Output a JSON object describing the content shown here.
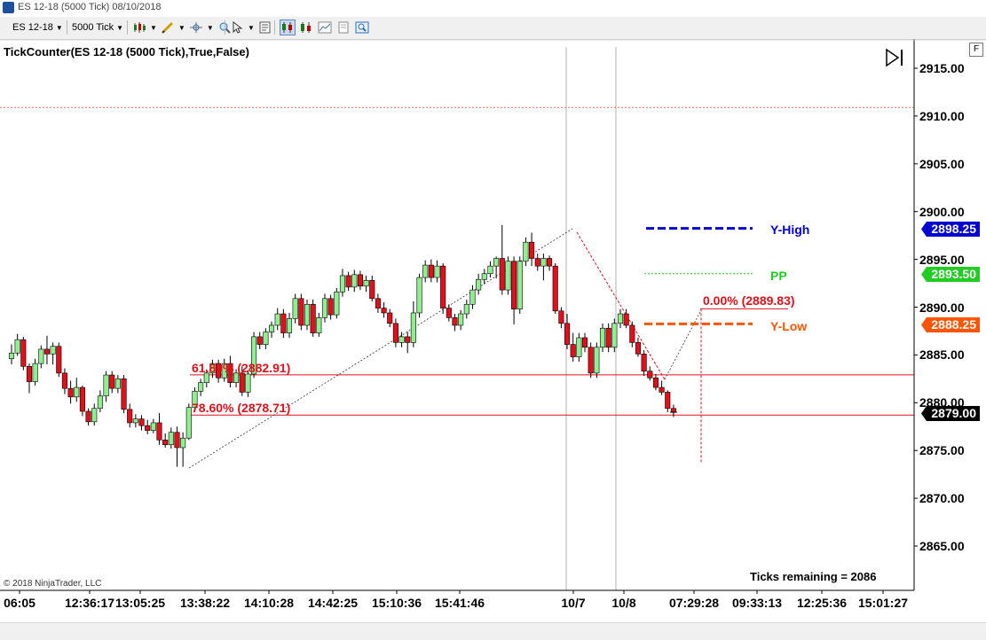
{
  "window": {
    "title": "ES 12-18 (5000 Tick)  08/10/2018"
  },
  "toolbar": {
    "instrument": "ES 12-18",
    "interval": "5000 Tick",
    "icons": [
      "bars-icon",
      "pencil-icon",
      "crosshair-icon",
      "zoom-icon",
      "pointer-icon",
      "chart-style-icon",
      "data-box-icon",
      "properties-icon"
    ]
  },
  "panel": {
    "f_label": "F"
  },
  "indicator": {
    "label": "TickCounter(ES 12-18 (5000 Tick),True,False)",
    "ticks_remaining": "Ticks remaining = 2086"
  },
  "copyright": "© 2018 NinjaTrader, LLC",
  "colors": {
    "up": "#90ee90",
    "down": "#e2101b",
    "yhigh": "#0000d0",
    "pp": "#22cc22",
    "ylow": "#ff5500",
    "fib": "#e2101b",
    "last": "#000000"
  },
  "chart_data": {
    "type": "candlestick",
    "ylim": [
      2861.5,
      2917.5
    ],
    "yticks": [
      "2915.00",
      "2910.00",
      "2905.00",
      "2900.00",
      "2895.00",
      "2890.00",
      "2885.00",
      "2880.00",
      "2875.00",
      "2870.00",
      "2865.00"
    ],
    "xticks": [
      "06:05",
      "12:36:17",
      "13:05:25",
      "13:38:22",
      "14:10:28",
      "14:42:25",
      "15:10:36",
      "15:41:46",
      "10/7",
      "10/8",
      "07:29:28",
      "09:33:13",
      "12:25:36",
      "15:01:27"
    ],
    "candles": [
      [
        2884.6,
        2886.1,
        2884.0,
        2885.2
      ],
      [
        2885.2,
        2887.2,
        2884.9,
        2886.6
      ],
      [
        2886.6,
        2886.9,
        2883.4,
        2883.8
      ],
      [
        2883.8,
        2884.1,
        2881.0,
        2882.2
      ],
      [
        2882.2,
        2884.6,
        2881.8,
        2884.1
      ],
      [
        2884.1,
        2886.0,
        2883.6,
        2885.6
      ],
      [
        2885.6,
        2887.0,
        2884.0,
        2885.1
      ],
      [
        2885.1,
        2886.3,
        2884.0,
        2885.9
      ],
      [
        2885.9,
        2886.3,
        2882.7,
        2883.1
      ],
      [
        2883.1,
        2883.6,
        2880.9,
        2881.5
      ],
      [
        2881.5,
        2882.3,
        2879.9,
        2880.6
      ],
      [
        2880.6,
        2882.6,
        2880.1,
        2881.6
      ],
      [
        2881.6,
        2881.8,
        2878.6,
        2879.1
      ],
      [
        2879.1,
        2879.4,
        2877.6,
        2878.0
      ],
      [
        2878.0,
        2879.9,
        2877.6,
        2879.4
      ],
      [
        2879.4,
        2881.3,
        2879.0,
        2880.7
      ],
      [
        2880.7,
        2883.3,
        2880.1,
        2882.9
      ],
      [
        2882.9,
        2883.3,
        2881.0,
        2881.5
      ],
      [
        2881.5,
        2882.9,
        2881.0,
        2882.5
      ],
      [
        2882.5,
        2882.9,
        2878.9,
        2879.3
      ],
      [
        2879.3,
        2879.9,
        2877.4,
        2877.9
      ],
      [
        2877.9,
        2878.8,
        2877.4,
        2878.3
      ],
      [
        2878.3,
        2878.7,
        2877.1,
        2877.6
      ],
      [
        2877.6,
        2878.2,
        2876.7,
        2877.1
      ],
      [
        2877.1,
        2878.3,
        2876.8,
        2877.9
      ],
      [
        2877.9,
        2878.9,
        2875.6,
        2876.1
      ],
      [
        2876.1,
        2876.8,
        2875.3,
        2875.6
      ],
      [
        2875.6,
        2877.4,
        2875.2,
        2876.9
      ],
      [
        2876.9,
        2877.5,
        2873.3,
        2875.3
      ],
      [
        2875.3,
        2876.9,
        2873.3,
        2876.3
      ],
      [
        2876.3,
        2879.9,
        2876.1,
        2879.5
      ],
      [
        2879.5,
        2881.6,
        2879.0,
        2881.2
      ],
      [
        2881.2,
        2882.5,
        2880.7,
        2882.1
      ],
      [
        2882.1,
        2883.5,
        2881.6,
        2883.1
      ],
      [
        2883.1,
        2884.5,
        2882.6,
        2884.1
      ],
      [
        2884.1,
        2884.5,
        2882.1,
        2882.6
      ],
      [
        2882.6,
        2884.6,
        2882.2,
        2884.1
      ],
      [
        2884.1,
        2884.9,
        2881.6,
        2882.1
      ],
      [
        2882.1,
        2883.5,
        2881.6,
        2883.1
      ],
      [
        2883.1,
        2883.8,
        2880.7,
        2881.1
      ],
      [
        2881.1,
        2883.4,
        2880.6,
        2883.0
      ],
      [
        2883.0,
        2887.4,
        2882.6,
        2886.9
      ],
      [
        2886.9,
        2887.4,
        2885.6,
        2886.1
      ],
      [
        2886.1,
        2887.8,
        2885.6,
        2887.4
      ],
      [
        2887.4,
        2888.5,
        2886.8,
        2888.1
      ],
      [
        2888.1,
        2889.9,
        2887.6,
        2889.3
      ],
      [
        2889.3,
        2889.8,
        2886.8,
        2887.3
      ],
      [
        2887.3,
        2889.4,
        2886.8,
        2888.8
      ],
      [
        2888.8,
        2891.4,
        2888.3,
        2890.9
      ],
      [
        2890.9,
        2891.4,
        2887.6,
        2888.1
      ],
      [
        2888.1,
        2890.8,
        2887.6,
        2890.3
      ],
      [
        2890.3,
        2890.8,
        2886.9,
        2887.3
      ],
      [
        2887.3,
        2889.4,
        2886.9,
        2888.9
      ],
      [
        2888.9,
        2891.4,
        2888.4,
        2890.9
      ],
      [
        2890.9,
        2891.3,
        2888.7,
        2889.2
      ],
      [
        2889.2,
        2892.0,
        2888.8,
        2891.6
      ],
      [
        2891.6,
        2894.0,
        2891.1,
        2893.3
      ],
      [
        2893.3,
        2893.7,
        2891.7,
        2892.1
      ],
      [
        2892.1,
        2893.9,
        2891.6,
        2893.4
      ],
      [
        2893.4,
        2893.8,
        2891.8,
        2892.2
      ],
      [
        2892.2,
        2893.3,
        2891.6,
        2892.8
      ],
      [
        2892.8,
        2893.3,
        2890.6,
        2890.9
      ],
      [
        2890.9,
        2891.4,
        2889.4,
        2889.9
      ],
      [
        2889.9,
        2890.5,
        2888.9,
        2889.4
      ],
      [
        2889.4,
        2889.8,
        2887.9,
        2888.3
      ],
      [
        2888.3,
        2888.8,
        2885.8,
        2886.3
      ],
      [
        2886.3,
        2887.4,
        2885.8,
        2886.9
      ],
      [
        2886.9,
        2887.4,
        2885.2,
        2886.3
      ],
      [
        2886.3,
        2890.6,
        2885.8,
        2889.4
      ],
      [
        2889.4,
        2893.5,
        2888.9,
        2893.1
      ],
      [
        2893.1,
        2894.9,
        2892.6,
        2894.4
      ],
      [
        2894.4,
        2895.0,
        2892.6,
        2893.1
      ],
      [
        2893.1,
        2894.9,
        2892.6,
        2894.3
      ],
      [
        2894.3,
        2894.6,
        2889.3,
        2889.9
      ],
      [
        2889.9,
        2890.3,
        2888.5,
        2888.9
      ],
      [
        2888.9,
        2889.3,
        2887.5,
        2888.1
      ],
      [
        2888.1,
        2889.7,
        2887.6,
        2889.3
      ],
      [
        2889.3,
        2890.8,
        2888.8,
        2890.3
      ],
      [
        2890.3,
        2892.3,
        2889.8,
        2891.8
      ],
      [
        2891.8,
        2893.5,
        2891.3,
        2892.9
      ],
      [
        2892.9,
        2894.0,
        2892.4,
        2893.5
      ],
      [
        2893.5,
        2894.8,
        2893.1,
        2894.3
      ],
      [
        2894.3,
        2895.3,
        2893.0,
        2895.1
      ],
      [
        2895.1,
        2898.6,
        2891.3,
        2891.8
      ],
      [
        2891.8,
        2895.3,
        2891.3,
        2894.8
      ],
      [
        2894.8,
        2895.3,
        2888.2,
        2889.8
      ],
      [
        2889.8,
        2895.3,
        2889.3,
        2894.8
      ],
      [
        2894.8,
        2897.3,
        2894.3,
        2896.8
      ],
      [
        2896.8,
        2897.8,
        2894.3,
        2895.1
      ],
      [
        2895.1,
        2895.6,
        2893.8,
        2894.3
      ],
      [
        2894.3,
        2895.6,
        2892.8,
        2895.1
      ],
      [
        2895.1,
        2895.4,
        2893.8,
        2894.3
      ],
      [
        2894.3,
        2894.6,
        2889.3,
        2889.6
      ],
      [
        2889.6,
        2890.0,
        2887.8,
        2888.3
      ],
      [
        2888.3,
        2889.3,
        2885.6,
        2886.1
      ],
      [
        2886.1,
        2887.3,
        2884.3,
        2884.8
      ],
      [
        2884.8,
        2887.3,
        2884.3,
        2886.8
      ],
      [
        2886.8,
        2887.3,
        2885.3,
        2885.8
      ],
      [
        2885.8,
        2886.3,
        2882.6,
        2883.1
      ],
      [
        2883.1,
        2886.3,
        2882.6,
        2885.8
      ],
      [
        2885.8,
        2888.3,
        2885.3,
        2887.8
      ],
      [
        2887.8,
        2888.3,
        2885.3,
        2885.8
      ],
      [
        2885.8,
        2888.8,
        2885.3,
        2888.3
      ],
      [
        2888.3,
        2889.8,
        2887.8,
        2889.3
      ],
      [
        2889.3,
        2889.8,
        2887.8,
        2888.1
      ],
      [
        2888.1,
        2888.5,
        2885.8,
        2886.3
      ],
      [
        2886.3,
        2886.8,
        2884.8,
        2885.1
      ],
      [
        2885.1,
        2885.5,
        2882.8,
        2883.3
      ],
      [
        2883.3,
        2883.8,
        2882.3,
        2882.6
      ],
      [
        2882.6,
        2883.0,
        2881.3,
        2881.6
      ],
      [
        2881.6,
        2882.3,
        2880.8,
        2881.1
      ],
      [
        2881.1,
        2881.3,
        2879.0,
        2879.4
      ],
      [
        2879.4,
        2879.8,
        2878.5,
        2879.0
      ]
    ],
    "levels": {
      "y_high": 2898.25,
      "pp": 2893.5,
      "y_low": 2888.25,
      "last": 2879.0
    },
    "price_tags": [
      "2898.25",
      "2893.50",
      "2888.25",
      "2879.00"
    ],
    "legend": [
      "Y-High",
      "PP",
      "Y-Low"
    ],
    "fib": {
      "labels": [
        "0.00% (2889.83)",
        "61.80% (2882.91)",
        "78.60% (2878.71)"
      ],
      "values": [
        2889.83,
        2882.91,
        2878.71
      ]
    },
    "resistance_line": 2910.9,
    "session_breaks": [
      "10/7",
      "10/8"
    ]
  }
}
